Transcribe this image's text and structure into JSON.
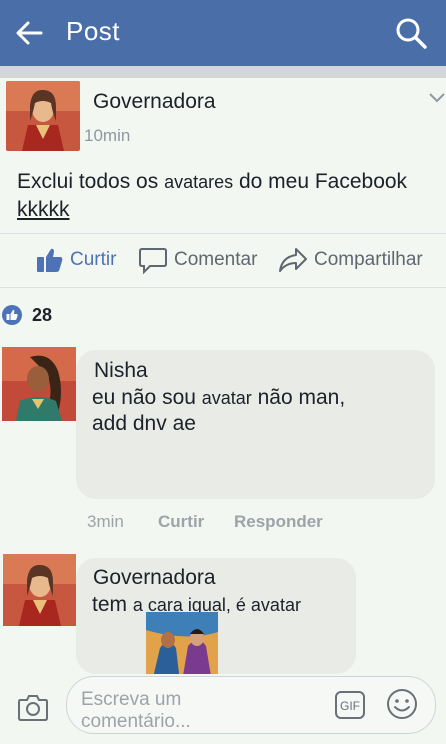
{
  "header": {
    "title": "Post",
    "back_icon": "arrow-left-icon",
    "search_icon": "search-icon",
    "color": "#4a6ea8"
  },
  "post": {
    "author": "Governadora",
    "time": "10min",
    "text_part1": "Exclui todos os ",
    "text_part2": "avatares",
    "text_part3": " do meu Facebook",
    "text_part4": "kkkkk",
    "actions": {
      "like": "Curtir",
      "comment": "Comentar",
      "share": "Compartilhar"
    },
    "reaction_count": "28"
  },
  "comments": [
    {
      "author": "Nisha",
      "text_part1": "eu não sou ",
      "text_part2": "avatar",
      "text_part3": " não man,",
      "text_line2": "add dnv ae",
      "time": "3min",
      "like": "Curtir",
      "reply": "Responder"
    },
    {
      "author": "Governadora",
      "text_part1": "tem ",
      "text_part2": "a cara igual, é avatar"
    }
  ],
  "composer": {
    "placeholder_line1": "Escreva um",
    "placeholder_line2": "comentário...",
    "gif_label": "GIF",
    "icons": [
      "camera-icon",
      "gif-icon",
      "emoji-icon"
    ]
  }
}
